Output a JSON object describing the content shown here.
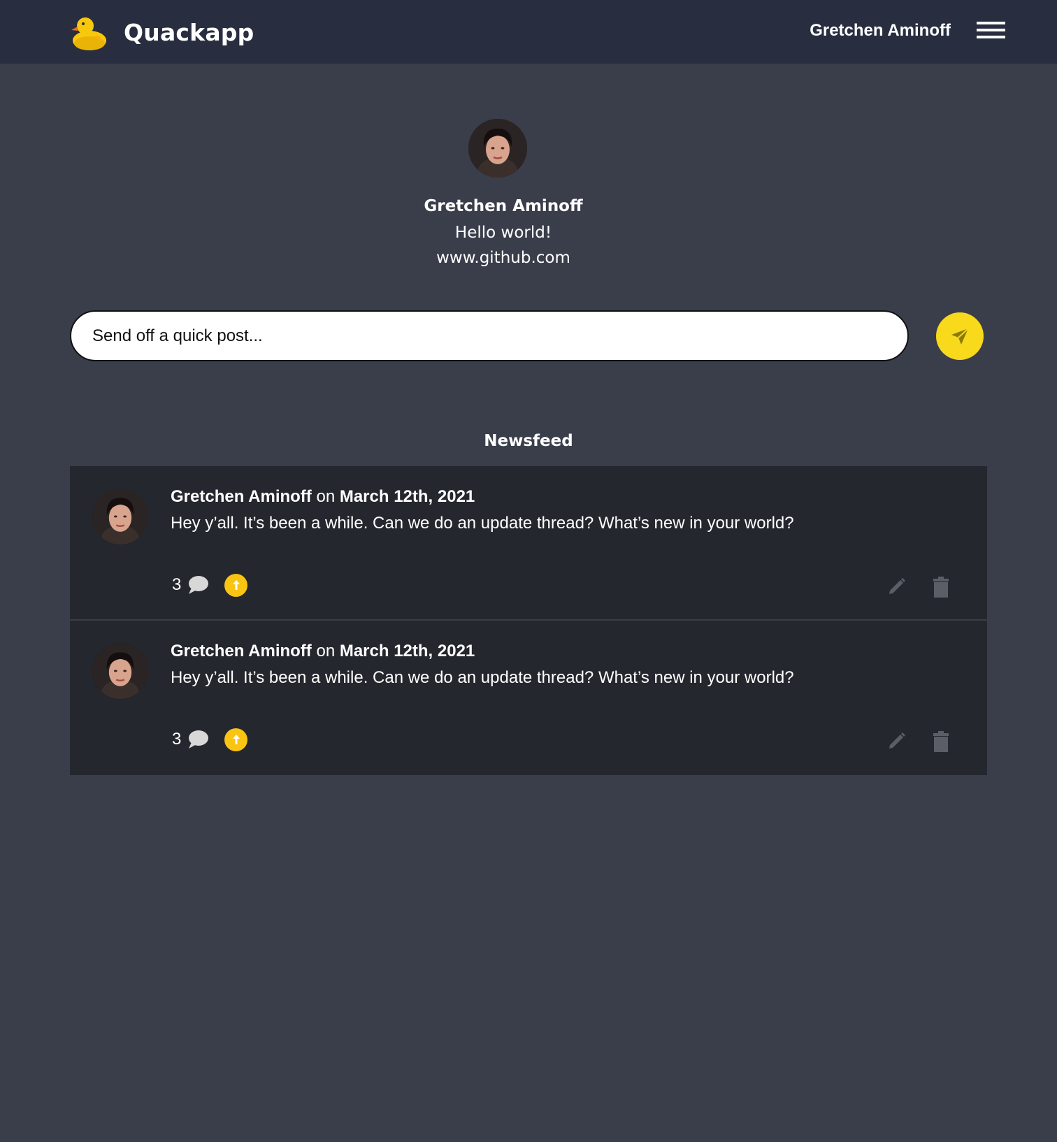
{
  "header": {
    "app_name": "Quackapp",
    "user_name": "Gretchen Aminoff",
    "logo_icon": "rubber-duck-icon",
    "menu_icon": "hamburger-menu-icon"
  },
  "profile": {
    "name": "Gretchen Aminoff",
    "bio": "Hello world!",
    "website": "www.github.com"
  },
  "composer": {
    "placeholder": "Send off a quick post...",
    "send_icon": "paper-plane-icon"
  },
  "feed": {
    "title": "Newsfeed",
    "posts": [
      {
        "author": "Gretchen Aminoff",
        "connector": "on",
        "date": "March 12th, 2021",
        "text": "Hey y’all. It’s been a while. Can we do an update thread? What’s new in your world?",
        "comment_count": "3"
      },
      {
        "author": "Gretchen Aminoff",
        "connector": "on",
        "date": "March 12th, 2021",
        "text": "Hey y’all. It’s been a while. Can we do an update thread? What’s new in your world?",
        "comment_count": "3"
      }
    ]
  },
  "colors": {
    "header_bg": "#282e3f",
    "page_bg": "#3a3e4a",
    "feed_bg": "#24272d",
    "accent_yellow": "#f9d91c",
    "upvote_yellow": "#f9c412"
  }
}
